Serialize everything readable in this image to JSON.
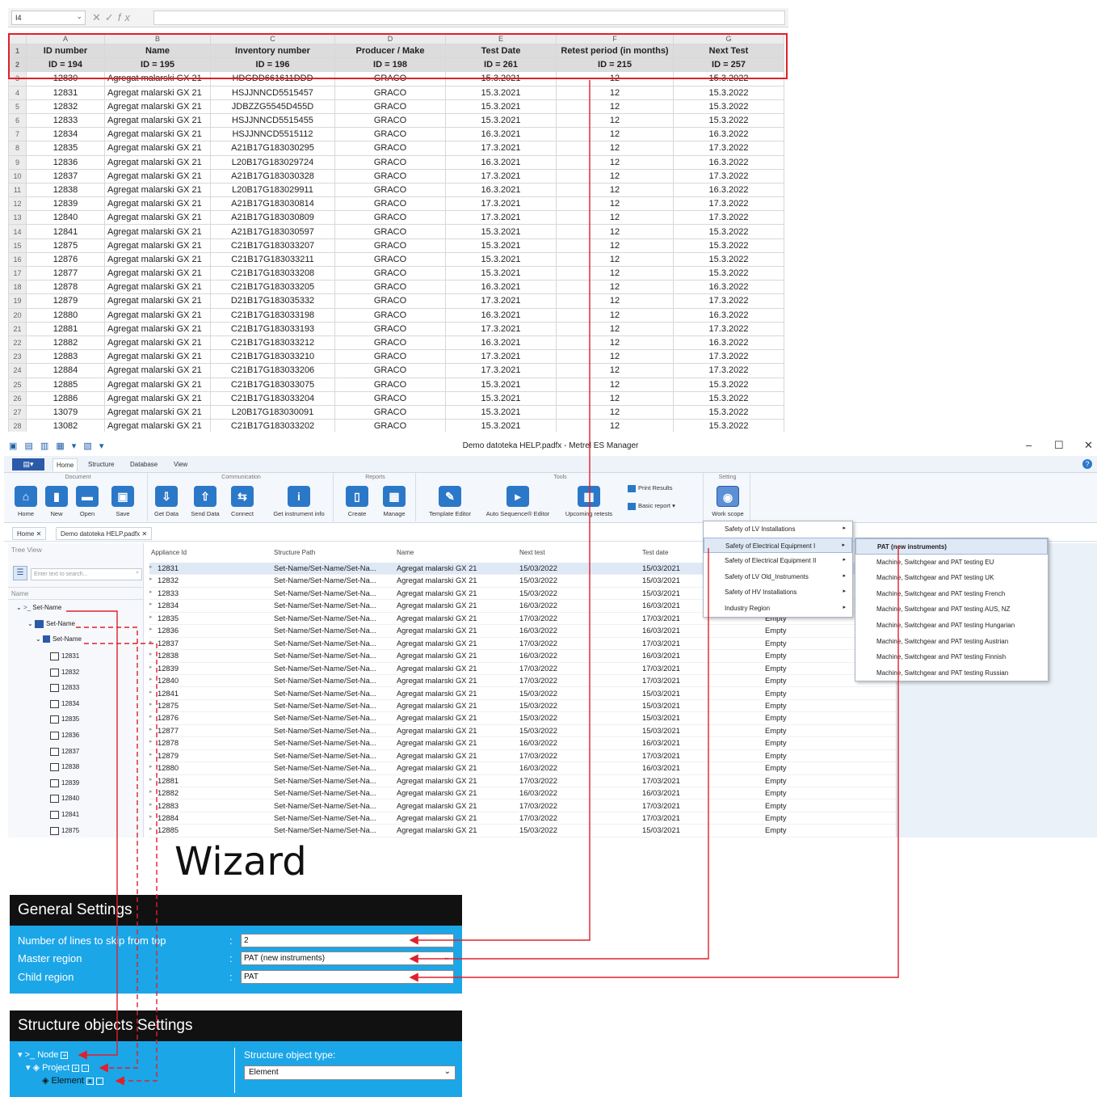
{
  "excel": {
    "name_box": "I4",
    "fx_label": "fx",
    "col_letters": [
      "A",
      "B",
      "C",
      "D",
      "E",
      "F",
      "G"
    ],
    "headers": [
      "ID number",
      "Name",
      "Inventory number",
      "Producer / Make",
      "Test Date",
      "Retest period (in months)",
      "Next Test"
    ],
    "id_row": [
      "ID = 194",
      "ID = 195",
      "ID = 196",
      "ID = 198",
      "ID = 261",
      "ID = 215",
      "ID = 257"
    ],
    "rows": [
      [
        "3",
        "12830",
        "Agregat malarski GX 21",
        "HDGDD661611DDD",
        "GRACO",
        "15.3.2021",
        "12",
        "15.3.2022"
      ],
      [
        "4",
        "12831",
        "Agregat malarski GX 21",
        "HSJJNNCD5515457",
        "GRACO",
        "15.3.2021",
        "12",
        "15.3.2022"
      ],
      [
        "5",
        "12832",
        "Agregat malarski GX 21",
        "JDBZZG5545D455D",
        "GRACO",
        "15.3.2021",
        "12",
        "15.3.2022"
      ],
      [
        "6",
        "12833",
        "Agregat malarski GX 21",
        "HSJJNNCD5515455",
        "GRACO",
        "15.3.2021",
        "12",
        "15.3.2022"
      ],
      [
        "7",
        "12834",
        "Agregat malarski GX 21",
        "HSJJNNCD5515112",
        "GRACO",
        "16.3.2021",
        "12",
        "16.3.2022"
      ],
      [
        "8",
        "12835",
        "Agregat malarski GX 21",
        "A21B17G183030295",
        "GRACO",
        "17.3.2021",
        "12",
        "17.3.2022"
      ],
      [
        "9",
        "12836",
        "Agregat malarski GX 21",
        "L20B17G183029724",
        "GRACO",
        "16.3.2021",
        "12",
        "16.3.2022"
      ],
      [
        "10",
        "12837",
        "Agregat malarski GX 21",
        "A21B17G183030328",
        "GRACO",
        "17.3.2021",
        "12",
        "17.3.2022"
      ],
      [
        "11",
        "12838",
        "Agregat malarski GX 21",
        "L20B17G183029911",
        "GRACO",
        "16.3.2021",
        "12",
        "16.3.2022"
      ],
      [
        "12",
        "12839",
        "Agregat malarski GX 21",
        "A21B17G183030814",
        "GRACO",
        "17.3.2021",
        "12",
        "17.3.2022"
      ],
      [
        "13",
        "12840",
        "Agregat malarski GX 21",
        "A21B17G183030809",
        "GRACO",
        "17.3.2021",
        "12",
        "17.3.2022"
      ],
      [
        "14",
        "12841",
        "Agregat malarski GX 21",
        "A21B17G183030597",
        "GRACO",
        "15.3.2021",
        "12",
        "15.3.2022"
      ],
      [
        "15",
        "12875",
        "Agregat malarski GX 21",
        "C21B17G183033207",
        "GRACO",
        "15.3.2021",
        "12",
        "15.3.2022"
      ],
      [
        "16",
        "12876",
        "Agregat malarski GX 21",
        "C21B17G183033211",
        "GRACO",
        "15.3.2021",
        "12",
        "15.3.2022"
      ],
      [
        "17",
        "12877",
        "Agregat malarski GX 21",
        "C21B17G183033208",
        "GRACO",
        "15.3.2021",
        "12",
        "15.3.2022"
      ],
      [
        "18",
        "12878",
        "Agregat malarski GX 21",
        "C21B17G183033205",
        "GRACO",
        "16.3.2021",
        "12",
        "16.3.2022"
      ],
      [
        "19",
        "12879",
        "Agregat malarski GX 21",
        "D21B17G183035332",
        "GRACO",
        "17.3.2021",
        "12",
        "17.3.2022"
      ],
      [
        "20",
        "12880",
        "Agregat malarski GX 21",
        "C21B17G183033198",
        "GRACO",
        "16.3.2021",
        "12",
        "16.3.2022"
      ],
      [
        "21",
        "12881",
        "Agregat malarski GX 21",
        "C21B17G183033193",
        "GRACO",
        "17.3.2021",
        "12",
        "17.3.2022"
      ],
      [
        "22",
        "12882",
        "Agregat malarski GX 21",
        "C21B17G183033212",
        "GRACO",
        "16.3.2021",
        "12",
        "16.3.2022"
      ],
      [
        "23",
        "12883",
        "Agregat malarski GX 21",
        "C21B17G183033210",
        "GRACO",
        "17.3.2021",
        "12",
        "17.3.2022"
      ],
      [
        "24",
        "12884",
        "Agregat malarski GX 21",
        "C21B17G183033206",
        "GRACO",
        "17.3.2021",
        "12",
        "17.3.2022"
      ],
      [
        "25",
        "12885",
        "Agregat malarski GX 21",
        "C21B17G183033075",
        "GRACO",
        "15.3.2021",
        "12",
        "15.3.2022"
      ],
      [
        "26",
        "12886",
        "Agregat malarski GX 21",
        "C21B17G183033204",
        "GRACO",
        "15.3.2021",
        "12",
        "15.3.2022"
      ],
      [
        "27",
        "13079",
        "Agregat malarski GX 21",
        "L20B17G183030091",
        "GRACO",
        "15.3.2021",
        "12",
        "15.3.2022"
      ],
      [
        "28",
        "13082",
        "Agregat malarski GX 21",
        "C21B17G183033202",
        "GRACO",
        "15.3.2021",
        "12",
        "15.3.2022"
      ]
    ]
  },
  "app": {
    "title": "Demo datoteka HELP.padfx - Metrel ES Manager",
    "file_button": "",
    "tabs": [
      "Home",
      "Structure",
      "Database",
      "View"
    ],
    "groups": [
      "Document",
      "Communication",
      "Reports",
      "Tools",
      "Setting"
    ],
    "buttons": {
      "home": "Home",
      "new": "New",
      "open": "Open",
      "save": "Save",
      "get_data": "Get Data",
      "send_data": "Send Data",
      "connect": "Connect",
      "get_instrument_info": "Get instrument info",
      "create": "Create",
      "manage": "Manage",
      "template_editor": "Template Editor",
      "auto_sequence_editor": "Auto Sequence® Editor",
      "upcoming_retests": "Upcoming retests",
      "print_results": "Print Results",
      "basic_report": "Basic report",
      "work_scope": "Work scope"
    },
    "doc_tabs": [
      "Home",
      "Demo datoteka HELP.padfx"
    ],
    "tree": {
      "title": "Tree View",
      "search_placeholder": "Enter text to search...",
      "name_header": "Name",
      "node": "Set-Name",
      "project": "Set-Name",
      "element": "Set-Name",
      "items": [
        "12831",
        "12832",
        "12833",
        "12834",
        "12835",
        "12836",
        "12837",
        "12838",
        "12839",
        "12840",
        "12841",
        "12875"
      ]
    },
    "grid": {
      "headers": [
        "Appliance Id",
        "Structure Path",
        "Name",
        "Next test",
        "Test date"
      ],
      "rows": [
        [
          "12831",
          "Set-Name/Set-Name/Set-Na...",
          "Agregat malarski GX 21",
          "15/03/2022",
          "15/03/2021",
          ""
        ],
        [
          "12832",
          "Set-Name/Set-Name/Set-Na...",
          "Agregat malarski GX 21",
          "15/03/2022",
          "15/03/2021",
          ""
        ],
        [
          "12833",
          "Set-Name/Set-Name/Set-Na...",
          "Agregat malarski GX 21",
          "15/03/2022",
          "15/03/2021",
          ""
        ],
        [
          "12834",
          "Set-Name/Set-Name/Set-Na...",
          "Agregat malarski GX 21",
          "16/03/2022",
          "16/03/2021",
          ""
        ],
        [
          "12835",
          "Set-Name/Set-Name/Set-Na...",
          "Agregat malarski GX 21",
          "17/03/2022",
          "17/03/2021",
          "Empty"
        ],
        [
          "12836",
          "Set-Name/Set-Name/Set-Na...",
          "Agregat malarski GX 21",
          "16/03/2022",
          "16/03/2021",
          "Empty"
        ],
        [
          "12837",
          "Set-Name/Set-Name/Set-Na...",
          "Agregat malarski GX 21",
          "17/03/2022",
          "17/03/2021",
          "Empty"
        ],
        [
          "12838",
          "Set-Name/Set-Name/Set-Na...",
          "Agregat malarski GX 21",
          "16/03/2022",
          "16/03/2021",
          "Empty"
        ],
        [
          "12839",
          "Set-Name/Set-Name/Set-Na...",
          "Agregat malarski GX 21",
          "17/03/2022",
          "17/03/2021",
          "Empty"
        ],
        [
          "12840",
          "Set-Name/Set-Name/Set-Na...",
          "Agregat malarski GX 21",
          "17/03/2022",
          "17/03/2021",
          "Empty"
        ],
        [
          "12841",
          "Set-Name/Set-Name/Set-Na...",
          "Agregat malarski GX 21",
          "15/03/2022",
          "15/03/2021",
          "Empty"
        ],
        [
          "12875",
          "Set-Name/Set-Name/Set-Na...",
          "Agregat malarski GX 21",
          "15/03/2022",
          "15/03/2021",
          "Empty"
        ],
        [
          "12876",
          "Set-Name/Set-Name/Set-Na...",
          "Agregat malarski GX 21",
          "15/03/2022",
          "15/03/2021",
          "Empty"
        ],
        [
          "12877",
          "Set-Name/Set-Name/Set-Na...",
          "Agregat malarski GX 21",
          "15/03/2022",
          "15/03/2021",
          "Empty"
        ],
        [
          "12878",
          "Set-Name/Set-Name/Set-Na...",
          "Agregat malarski GX 21",
          "16/03/2022",
          "16/03/2021",
          "Empty"
        ],
        [
          "12879",
          "Set-Name/Set-Name/Set-Na...",
          "Agregat malarski GX 21",
          "17/03/2022",
          "17/03/2021",
          "Empty"
        ],
        [
          "12880",
          "Set-Name/Set-Name/Set-Na...",
          "Agregat malarski GX 21",
          "16/03/2022",
          "16/03/2021",
          "Empty"
        ],
        [
          "12881",
          "Set-Name/Set-Name/Set-Na...",
          "Agregat malarski GX 21",
          "17/03/2022",
          "17/03/2021",
          "Empty"
        ],
        [
          "12882",
          "Set-Name/Set-Name/Set-Na...",
          "Agregat malarski GX 21",
          "16/03/2022",
          "16/03/2021",
          "Empty"
        ],
        [
          "12883",
          "Set-Name/Set-Name/Set-Na...",
          "Agregat malarski GX 21",
          "17/03/2022",
          "17/03/2021",
          "Empty"
        ],
        [
          "12884",
          "Set-Name/Set-Name/Set-Na...",
          "Agregat malarski GX 21",
          "17/03/2022",
          "17/03/2021",
          "Empty"
        ],
        [
          "12885",
          "Set-Name/Set-Name/Set-Na...",
          "Agregat malarski GX 21",
          "15/03/2022",
          "15/03/2021",
          "Empty"
        ]
      ]
    },
    "work_scope_menu": [
      "Safety of LV Installations",
      "Safety of Electrical Equipment I",
      "Safety of Electrical Equipment II",
      "Safety of LV Old_Instruments",
      "Safety of HV Installations",
      "Industry Region"
    ],
    "submenu": [
      "PAT (new instruments)",
      "Machine, Switchgear and PAT testing EU",
      "Machine, Switchgear and PAT testing UK",
      "Machine, Switchgear and PAT testing French",
      "Machine, Switchgear and PAT testing AUS, NZ",
      "Machine, Switchgear and PAT testing Hungarian",
      "Machine, Switchgear and PAT testing Austrian",
      "Machine, Switchgear and PAT testing Finnish",
      "Machine, Switchgear and PAT testing Russian"
    ]
  },
  "wizard": {
    "title": "Wizard",
    "general": {
      "heading": "General Settings",
      "fields": [
        {
          "label": "Number of lines to skip from top",
          "value": "2"
        },
        {
          "label": "Master region",
          "value": "PAT (new instruments)"
        },
        {
          "label": "Child region",
          "value": "PAT"
        }
      ]
    },
    "structure": {
      "heading": "Structure objects Settings",
      "nodes": [
        "Node",
        "Project",
        "Element"
      ],
      "type_label": "Structure object type:",
      "type_value": "Element"
    }
  },
  "colors": {
    "accent_red": "#e0202a",
    "wizard_blue": "#1ba6e8",
    "ribbon_blue": "#2b78c9"
  }
}
